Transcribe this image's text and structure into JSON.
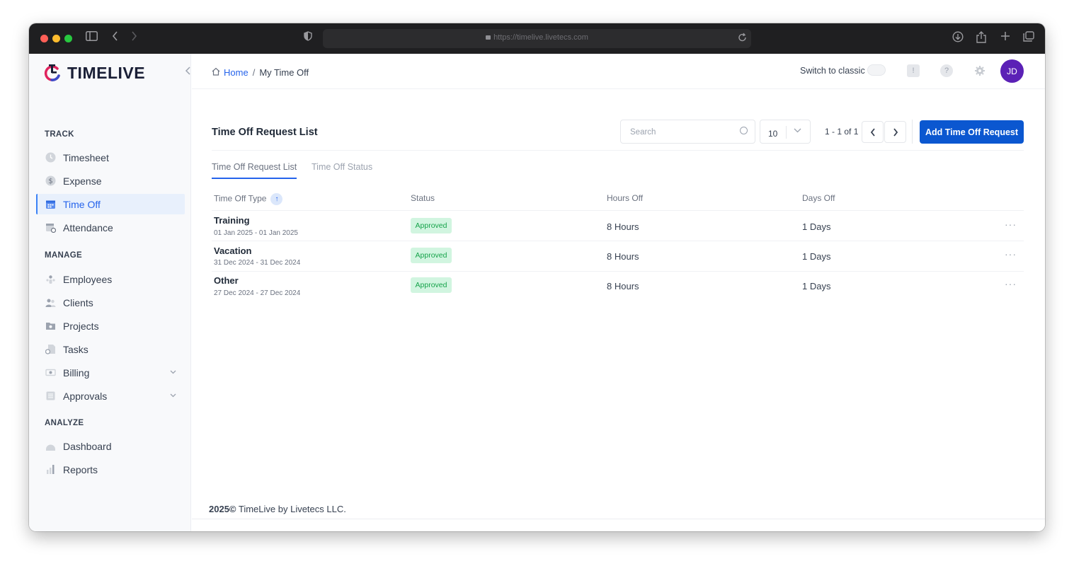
{
  "browser": {
    "url": "https://timelive.livetecs.com"
  },
  "brand": {
    "name": "TIMELIVE",
    "accent": "#0b57d0"
  },
  "sidebar": {
    "sections": [
      {
        "title": "TRACK"
      },
      {
        "title": "MANAGE"
      },
      {
        "title": "ANALYZE"
      }
    ],
    "items": [
      {
        "label": "Timesheet",
        "icon": "clock-icon"
      },
      {
        "label": "Expense",
        "icon": "dollar-icon"
      },
      {
        "label": "Time Off",
        "icon": "calendar-icon",
        "active": true
      },
      {
        "label": "Attendance",
        "icon": "calendar-check-icon"
      },
      {
        "label": "Employees",
        "icon": "employees-icon"
      },
      {
        "label": "Clients",
        "icon": "clients-icon"
      },
      {
        "label": "Projects",
        "icon": "folder-icon"
      },
      {
        "label": "Tasks",
        "icon": "tasks-icon"
      },
      {
        "label": "Billing",
        "icon": "billing-icon"
      },
      {
        "label": "Approvals",
        "icon": "approvals-icon"
      },
      {
        "label": "Dashboard",
        "icon": "dashboard-icon"
      },
      {
        "label": "Reports",
        "icon": "bar-chart-icon"
      }
    ]
  },
  "header": {
    "breadcrumb": {
      "home": "Home",
      "separator": "/",
      "current": "My Time Off"
    },
    "switch_label": "Switch to classic",
    "avatar_initials": "JD"
  },
  "list": {
    "title": "Time Off Request List",
    "search_placeholder": "Search",
    "page_size": "10",
    "range": "1 - 1 of 1",
    "add_button": "Add Time Off Request",
    "tabs": [
      {
        "label": "Time Off Request List",
        "active": true
      },
      {
        "label": "Time Off Status",
        "active": false
      }
    ],
    "columns": [
      "Time Off Type",
      "Status",
      "Hours Off",
      "Days Off"
    ],
    "rows": [
      {
        "type": "Training",
        "dates": "01 Jan 2025 - 01 Jan 2025",
        "status": "Approved",
        "hours": "8 Hours",
        "days": "1 Days"
      },
      {
        "type": "Vacation",
        "dates": "31 Dec 2024 - 31 Dec 2024",
        "status": "Approved",
        "hours": "8 Hours",
        "days": "1 Days"
      },
      {
        "type": "Other",
        "dates": "27 Dec 2024 - 27 Dec 2024",
        "status": "Approved",
        "hours": "8 Hours",
        "days": "1 Days"
      }
    ],
    "row_more": "···"
  },
  "footer": {
    "year": "2025©",
    "text": " TimeLive by Livetecs LLC."
  }
}
